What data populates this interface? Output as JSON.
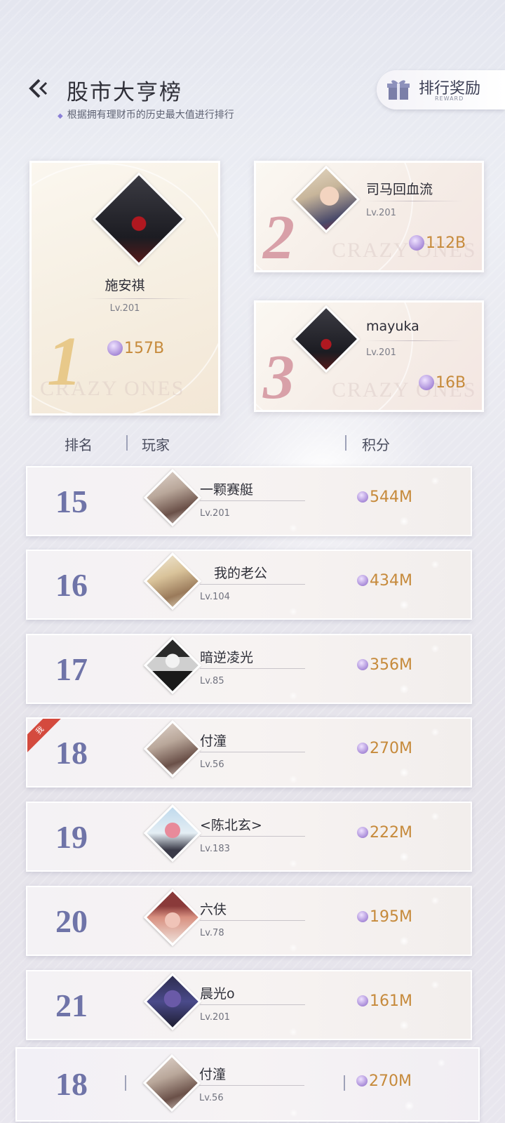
{
  "header": {
    "title": "股市大亨榜",
    "subtitle": "根据拥有理财币的历史最大值进行排行",
    "reward_label": "排行奖励",
    "reward_sub": "REWARD"
  },
  "top3": [
    {
      "rank": "1",
      "name": "施安祺",
      "level": "Lv.201",
      "score": "157B",
      "watermark": "CRAZY ONES"
    },
    {
      "rank": "2",
      "name": "司马回血流",
      "level": "Lv.201",
      "score": "112B",
      "watermark": "CRAZY ONES"
    },
    {
      "rank": "3",
      "name": "mayuka",
      "level": "Lv.201",
      "score": "16B",
      "watermark": "CRAZY ONES"
    }
  ],
  "columns": {
    "rank": "排名",
    "player": "玩家",
    "score": "积分"
  },
  "rows": [
    {
      "rank": "15",
      "name": "一颗赛艇",
      "level": "Lv.201",
      "score": "544M"
    },
    {
      "rank": "16",
      "name": "我的老公",
      "level": "Lv.104",
      "score": "434M"
    },
    {
      "rank": "17",
      "name": "暗逆凌光",
      "level": "Lv.85",
      "score": "356M"
    },
    {
      "rank": "18",
      "name": "付潼",
      "level": "Lv.56",
      "score": "270M",
      "badge": "我"
    },
    {
      "rank": "19",
      "name": "<陈北玄>",
      "level": "Lv.183",
      "score": "222M"
    },
    {
      "rank": "20",
      "name": "六伕",
      "level": "Lv.78",
      "score": "195M"
    },
    {
      "rank": "21",
      "name": "晨光o",
      "level": "Lv.201",
      "score": "161M"
    }
  ],
  "my_rank": {
    "rank": "18",
    "name": "付潼",
    "level": "Lv.56",
    "score": "270M"
  },
  "colors": {
    "rank_text": "#6f74a8",
    "score_text": "#c68a3b",
    "gold_rank": "#e8c98a",
    "pink_rank": "#d8a0a8",
    "me_badge": "#d44a3e"
  }
}
